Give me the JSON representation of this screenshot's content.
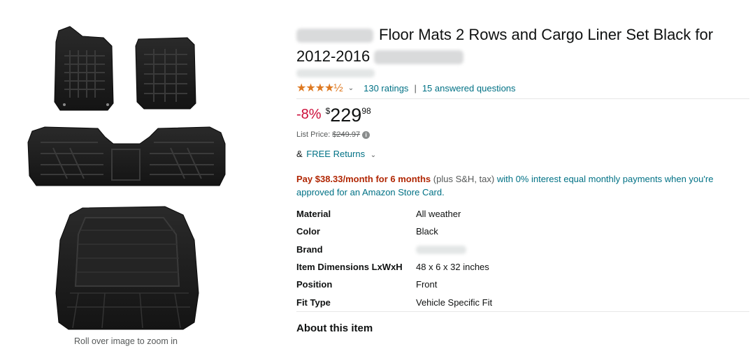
{
  "gallery": {
    "zoom_hint": "Roll over image to zoom in"
  },
  "product": {
    "title": "Floor Mats 2 Rows and Cargo Liner Set Black for 2012-2016",
    "title_part1": "Floor Mats 2 Rows and Cargo Liner Set Black for",
    "title_part2": "2012-2016"
  },
  "rating": {
    "stars_value": 4.5,
    "stars_glyphs": "★★★★½",
    "ratings_count": "130 ratings",
    "separator": "|",
    "answered_questions": "15 answered questions"
  },
  "price": {
    "discount": "-8%",
    "currency": "$",
    "whole": "229",
    "fraction": "98",
    "list_price_label": "List Price:",
    "list_price_value": "$249.97"
  },
  "returns": {
    "prefix": "&",
    "label": "FREE Returns"
  },
  "financing": {
    "highlight": "Pay $38.33/month for 6 months",
    "plain": "(plus S&H, tax)",
    "rest": "with 0% interest equal monthly payments when you're approved for an Amazon Store Card."
  },
  "specs": [
    {
      "key": "Material",
      "value": "All weather"
    },
    {
      "key": "Color",
      "value": "Black"
    },
    {
      "key": "Brand",
      "value": ""
    },
    {
      "key": "Item Dimensions LxWxH",
      "value": "48 x 6 x 32 inches"
    },
    {
      "key": "Position",
      "value": "Front"
    },
    {
      "key": "Fit Type",
      "value": "Vehicle Specific Fit"
    }
  ],
  "about": {
    "heading": "About this item"
  },
  "colors": {
    "star": "#de7921",
    "link": "#007185",
    "deal": "#cc0c39",
    "finance": "#b12704",
    "mat": "#1c1c1c"
  }
}
